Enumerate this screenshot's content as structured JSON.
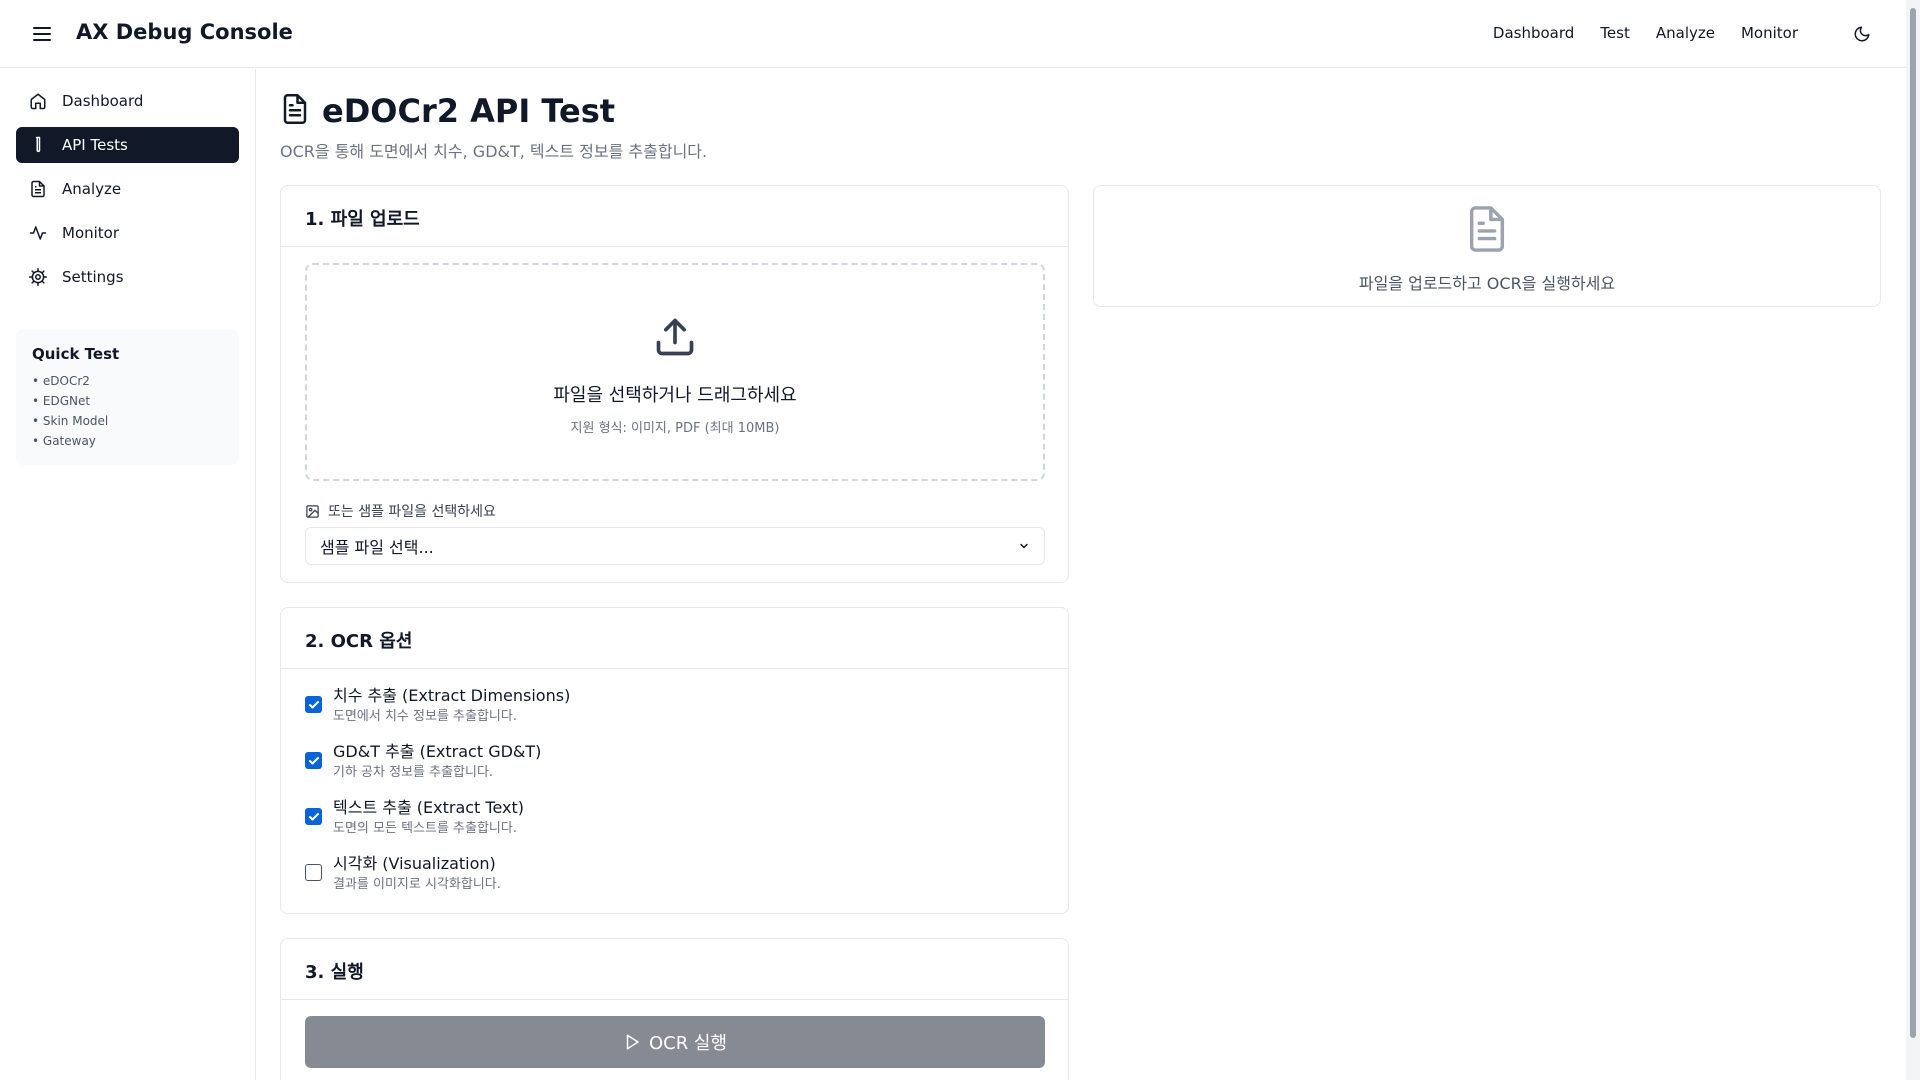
{
  "header": {
    "title": "AX Debug Console",
    "nav": [
      "Dashboard",
      "Test",
      "Analyze",
      "Monitor"
    ]
  },
  "sidebar": {
    "items": [
      {
        "label": "Dashboard",
        "icon": "home-icon"
      },
      {
        "label": "API Tests",
        "icon": "test-tube-icon",
        "active": true
      },
      {
        "label": "Analyze",
        "icon": "file-text-icon"
      },
      {
        "label": "Monitor",
        "icon": "activity-icon"
      },
      {
        "label": "Settings",
        "icon": "gear-icon"
      }
    ],
    "quick_test": {
      "title": "Quick Test",
      "items": [
        "• eDOCr2",
        "• EDGNet",
        "• Skin Model",
        "• Gateway"
      ]
    }
  },
  "page": {
    "title": "eDOCr2 API Test",
    "subtitle": "OCR을 통해 도면에서 치수, GD&T, 텍스트 정보를 추출합니다."
  },
  "upload": {
    "heading": "1. 파일 업로드",
    "dropzone_text": "파일을 선택하거나 드래그하세요",
    "dropzone_hint": "지원 형식: 이미지, PDF (최대 10MB)",
    "sample_label": "또는 샘플 파일을 선택하세요",
    "sample_select_value": "샘플 파일 선택..."
  },
  "options": {
    "heading": "2. OCR 옵션",
    "items": [
      {
        "title": "치수 추출 (Extract Dimensions)",
        "desc": "도면에서 치수 정보를 추출합니다.",
        "checked": true
      },
      {
        "title": "GD&T 추출 (Extract GD&T)",
        "desc": "기하 공차 정보를 추출합니다.",
        "checked": true
      },
      {
        "title": "텍스트 추출 (Extract Text)",
        "desc": "도면의 모든 텍스트를 추출합니다.",
        "checked": true
      },
      {
        "title": "시각화 (Visualization)",
        "desc": "결과를 이미지로 시각화합니다.",
        "checked": false
      }
    ]
  },
  "run": {
    "heading": "3. 실행",
    "button_label": "OCR 실행"
  },
  "result": {
    "empty_message": "파일을 업로드하고 OCR을 실행하세요"
  },
  "colors": {
    "active_nav_bg": "#111827",
    "checkbox_accent": "#0b63d6",
    "run_button_bg": "#858a93"
  }
}
